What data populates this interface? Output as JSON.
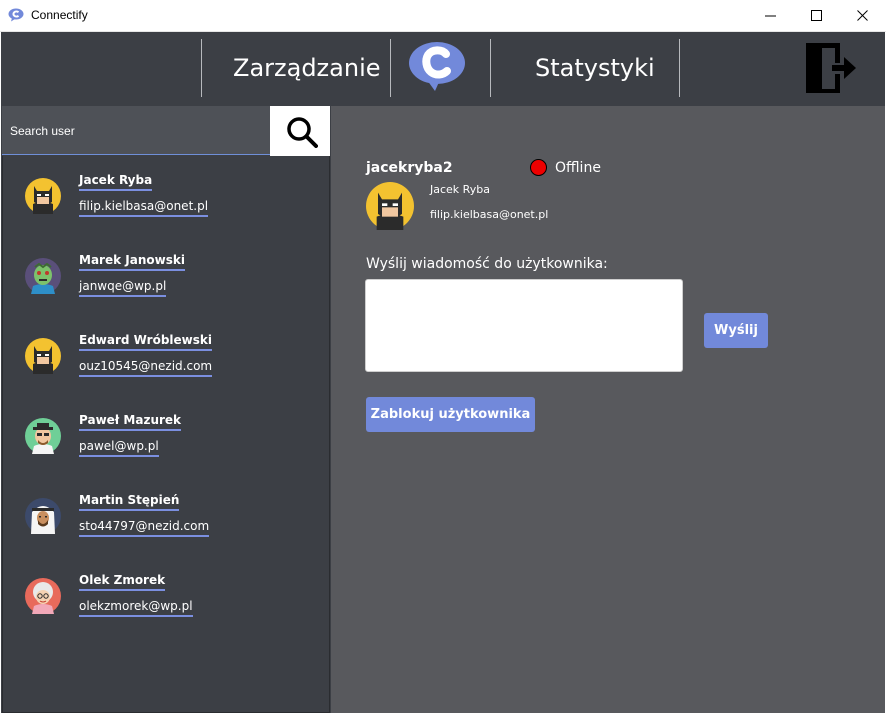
{
  "window": {
    "title": "Connectify"
  },
  "nav": {
    "manage_label": "Zarządzanie",
    "stats_label": "Statystyki",
    "logo_icon": "connectify-logo-icon",
    "logout_icon": "logout-door-icon"
  },
  "search": {
    "placeholder": "Search user",
    "icon": "search-icon"
  },
  "users": [
    {
      "name": "Jacek Ryba",
      "email": "filip.kielbasa@onet.pl",
      "avatar": "batman-avatar"
    },
    {
      "name": "Marek Janowski",
      "email": "janwqe@wp.pl",
      "avatar": "zombie-avatar"
    },
    {
      "name": "Edward  Wróblewski",
      "email": "ouz10545@nezid.com",
      "avatar": "batman-avatar"
    },
    {
      "name": "Paweł Mazurek",
      "email": "pawel@wp.pl",
      "avatar": "heisenberg-avatar"
    },
    {
      "name": "Martin  Stępień",
      "email": "sto44797@nezid.com",
      "avatar": "sheikh-avatar"
    },
    {
      "name": "Olek Zmorek",
      "email": "olekzmorek@wp.pl",
      "avatar": "grandma-avatar"
    }
  ],
  "detail": {
    "username": "jacekryba2",
    "status": "Offline",
    "status_color": "#ee0000",
    "full_name": "Jacek Ryba",
    "email": "filip.kielbasa@onet.pl",
    "message_label": "Wyślij wiadomość do użytkownika:",
    "message_value": "",
    "send_label": "Wyślij",
    "block_label": "Zablokuj użytkownika"
  },
  "colors": {
    "accent": "#7289da",
    "nav_bg": "#3c3f45",
    "main_bg": "#58595d"
  }
}
